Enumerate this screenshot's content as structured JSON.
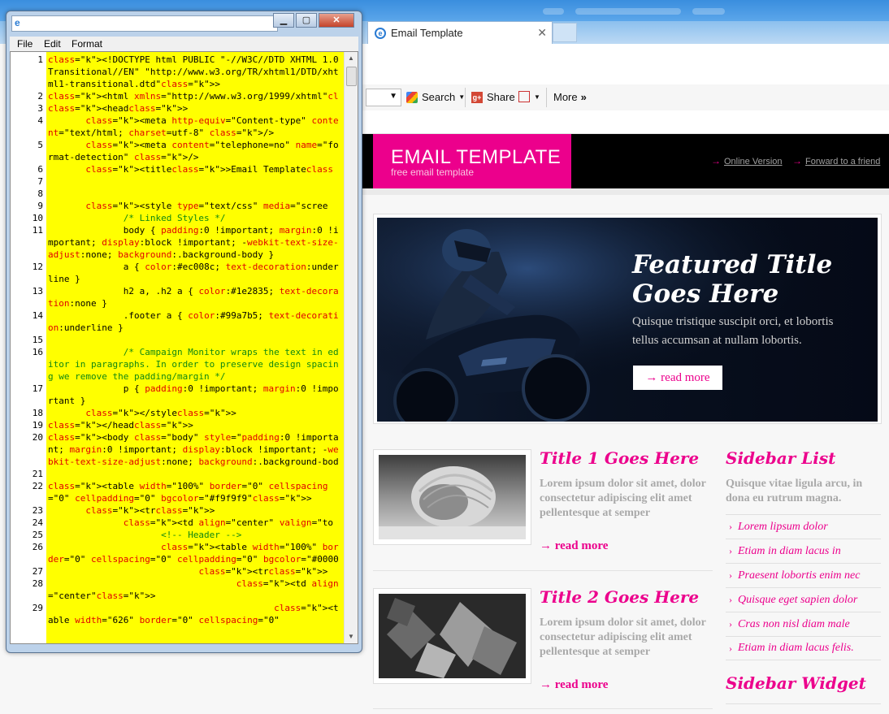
{
  "browser": {
    "tab_title": "Email Template",
    "tab_close": "✕",
    "toolbar": {
      "search_label": "Search",
      "share_label": "Share",
      "more_label": "More",
      "more_arrow": "»"
    }
  },
  "email": {
    "brand_title": "EMAIL TEMPLATE",
    "brand_subtitle": "free email template",
    "links": [
      "Online Version",
      "Forward to a friend"
    ],
    "hero": {
      "title": "Featured Title Goes Here",
      "text": "Quisque tristique suscipit orci, et lobortis tellus accumsan at nullam lobortis.",
      "button": "→ read more"
    },
    "articles": [
      {
        "title": "Title 1 Goes Here",
        "text": "Lorem ipsum dolor sit amet, dolor consectetur adipiscing elit amet pellentesque at semper",
        "more": "→ read more"
      },
      {
        "title": "Title 2 Goes Here",
        "text": "Lorem ipsum dolor sit amet, dolor consectetur adipiscing elit amet pellentesque at semper",
        "more": "→ read more"
      }
    ],
    "sidebar": {
      "list_title": "Sidebar List",
      "list_text": "Quisque vitae ligula arcu, in dona eu rutrum magna.",
      "items": [
        "Lorem lipsum dolor",
        "Etiam in diam lacus in",
        "Praesent lobortis enim nec",
        "Quisque eget sapien dolor",
        "Cras non nisl diam male",
        "Etiam in diam lacus felis."
      ],
      "widget_title": "Sidebar Widget"
    }
  },
  "editor": {
    "menu": [
      "File",
      "Edit",
      "Format"
    ],
    "line_numbers": [
      "1",
      "2",
      "3",
      "4",
      "5",
      "6",
      "7",
      "8",
      "9",
      "10",
      "11",
      "12",
      "13",
      "14",
      "15",
      "16",
      "17",
      "18",
      "19",
      "20",
      "21",
      "22",
      "23",
      "24",
      "25",
      "26",
      "27",
      "28",
      "29"
    ],
    "code": [
      "<!DOCTYPE html PUBLIC \"-//W3C//DTD XHTML 1.0 Transitional//EN\" \"http://www.w3.org/TR/xhtml1/DTD/xhtml1-transitional.dtd\">",
      "<html xmlns=\"http://www.w3.org/1999/xhtml\">",
      "<head>",
      "       <meta http-equiv=\"Content-type\" content=\"text/html; charset=utf-8\" />",
      "       <meta content=\"telephone=no\" name=\"format-detection\" />",
      "       <title>Email Template</title>",
      "",
      "",
      "       <style type=\"text/css\" media=\"screen\">",
      "              /* Linked Styles */",
      "              body { padding:0 !important; margin:0 !important; display:block !important; -webkit-text-size-adjust:none; background:.background-body }",
      "              a { color:#ec008c; text-decoration:underline }",
      "              h2 a, .h2 a { color:#1e2835; text-decoration:none }",
      "              .footer a { color:#99a7b5; text-decoration:underline }",
      "",
      "              /* Campaign Monitor wraps the text in editor in paragraphs. In order to preserve design spacing we remove the padding/margin */",
      "              p { padding:0 !important; margin:0 !important }",
      "       </style>",
      "</head>",
      "<body class=\"body\" style=\"padding:0 !important; margin:0 !important; display:block !important; -webkit-text-size-adjust:none; background:.background-body\">",
      "",
      "<table width=\"100%\" border=\"0\" cellspacing=\"0\" cellpadding=\"0\" bgcolor=\"#f9f9f9\">",
      "       <tr>",
      "              <td align=\"center\" valign=\"top\">",
      "                     <!-- Header -->",
      "                     <table width=\"100%\" border=\"0\" cellspacing=\"0\" cellpadding=\"0\" bgcolor=\"#000000\">",
      "                            <tr>",
      "                                   <td align=\"center\">",
      "                                          <table width=\"626\" border=\"0\" cellspacing=\"0\""
    ]
  },
  "colors": {
    "accent": "#ec008c",
    "code_bg": "#ffff00",
    "header_bg": "#000000"
  }
}
